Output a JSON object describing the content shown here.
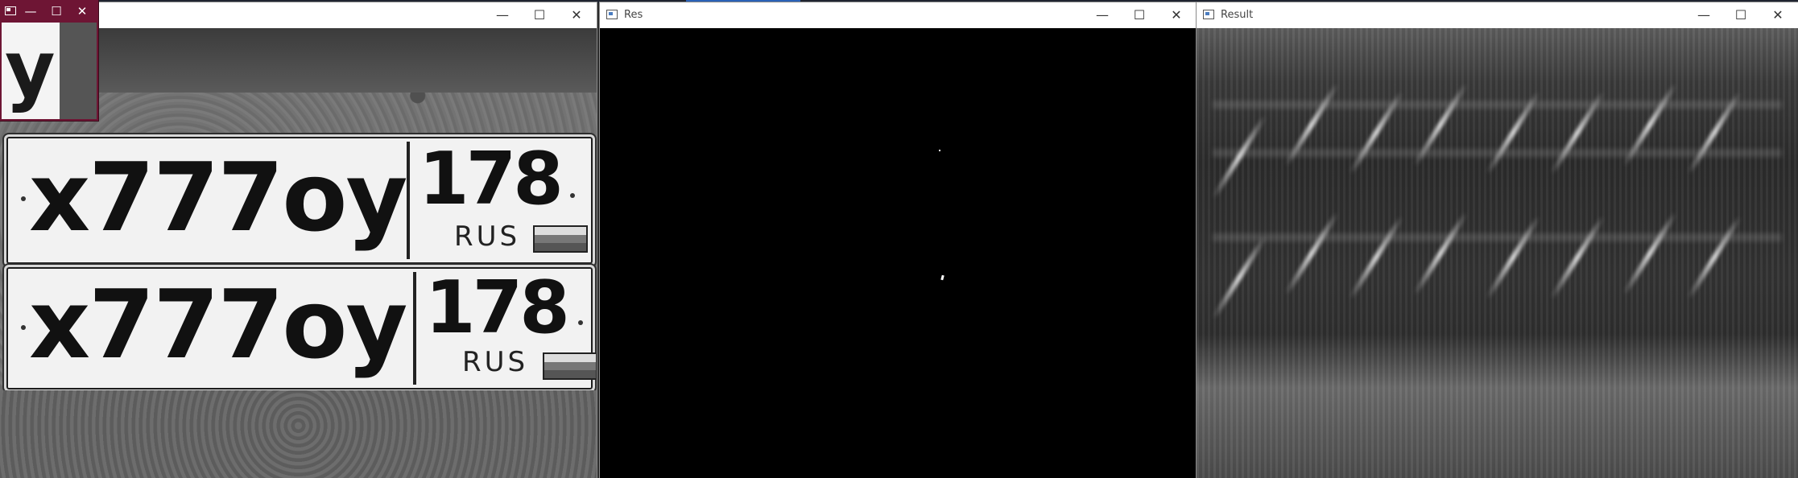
{
  "windows": [
    {
      "title": "",
      "controls": {
        "minimize": "—",
        "maximize": "☐",
        "close": "✕"
      },
      "image": {
        "plates": [
          {
            "number": "x777oy",
            "region": "178",
            "country": "RUS"
          },
          {
            "number": "x777oy",
            "region": "178",
            "country": "RUS"
          }
        ]
      }
    },
    {
      "title": "Res",
      "controls": {
        "minimize": "—",
        "maximize": "☐",
        "close": "✕"
      }
    },
    {
      "title": "Result",
      "controls": {
        "minimize": "—",
        "maximize": "☐",
        "close": "✕"
      }
    }
  ],
  "mini_window": {
    "controls": {
      "minimize": "—",
      "maximize": "☐",
      "close": "✕"
    },
    "glyph": "y",
    "accent_color": "#6e1534"
  }
}
